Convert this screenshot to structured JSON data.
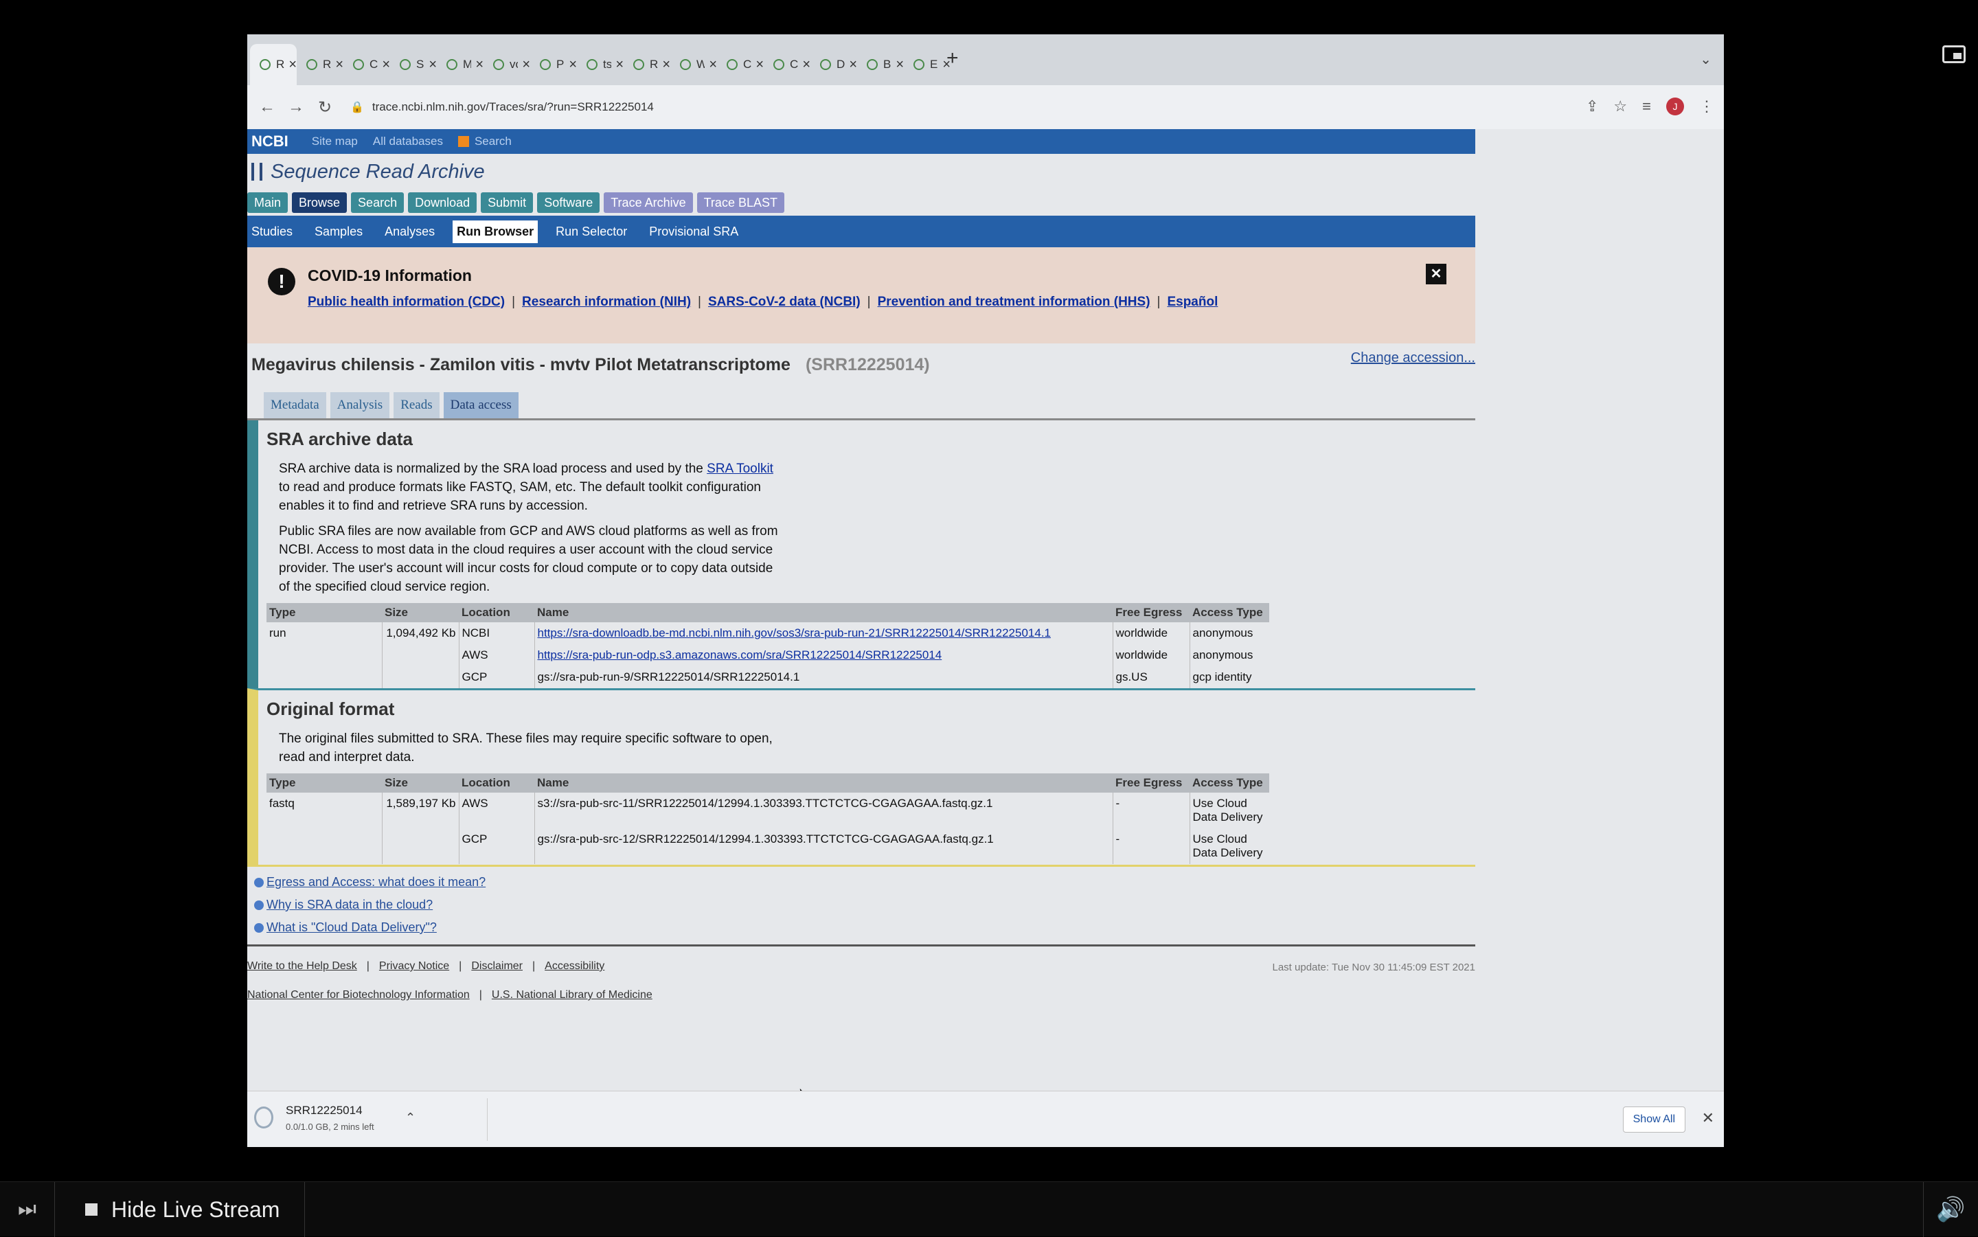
{
  "browser": {
    "tabs": [
      {
        "label": "Run Brow",
        "active": true
      },
      {
        "label": "Run Brow"
      },
      {
        "label": "Conda –"
      },
      {
        "label": "Sra Tools"
      },
      {
        "label": "MEGAHI"
      },
      {
        "label": "voutcn/m"
      },
      {
        "label": "Prokka:"
      },
      {
        "label": "tseeman"
      },
      {
        "label": "RStudio"
      },
      {
        "label": "Welcome"
      },
      {
        "label": "Conda +"
      },
      {
        "label": "Create E"
      },
      {
        "label": "Data visu"
      },
      {
        "label": "Basic his"
      },
      {
        "label": "Echo"
      }
    ],
    "url": "trace.ncbi.nlm.nih.gov/Traces/sra/?run=SRR12225014",
    "profile_initial": "J"
  },
  "ncbi": {
    "logo": "NCBI",
    "top_links": [
      "Site map",
      "All databases",
      "Search"
    ]
  },
  "sra": {
    "title": "Sequence Read Archive",
    "nav_main": [
      {
        "label": "Main"
      },
      {
        "label": "Browse",
        "active": true
      },
      {
        "label": "Search"
      },
      {
        "label": "Download"
      },
      {
        "label": "Submit"
      },
      {
        "label": "Software"
      },
      {
        "label": "Trace Archive",
        "trace": true
      },
      {
        "label": "Trace BLAST",
        "trace": true
      }
    ],
    "nav_sub": [
      {
        "label": "Studies"
      },
      {
        "label": "Samples"
      },
      {
        "label": "Analyses"
      },
      {
        "label": "Run Browser",
        "active": true
      },
      {
        "label": "Run Selector"
      },
      {
        "label": "Provisional SRA"
      }
    ]
  },
  "covid": {
    "title": "COVID-19 Information",
    "links": [
      "Public health information (CDC)",
      "Research information (NIH)",
      "SARS-CoV-2 data (NCBI)",
      "Prevention and treatment information (HHS)",
      "Español"
    ]
  },
  "run": {
    "title": "Megavirus chilensis - Zamilon vitis - mvtv Pilot Metatranscriptome",
    "accession": "(SRR12225014)",
    "change_accession": "Change accession...",
    "tabs": [
      "Metadata",
      "Analysis",
      "Reads",
      "Data access"
    ],
    "active_tab": "Data access"
  },
  "archive": {
    "title": "SRA archive data",
    "para1_pre": "SRA archive data is normalized by the SRA load process and used by the ",
    "para1_link": "SRA Toolkit",
    "para1_post": " to read and produce formats like FASTQ, SAM, etc. The default toolkit configuration enables it to find and retrieve SRA runs by accession.",
    "para2": "Public SRA files are now available from GCP and AWS cloud platforms as well as from NCBI. Access to most data in the cloud requires a user account with the cloud service provider. The user's account will incur costs for cloud compute or to copy data outside of the specified cloud service region.",
    "headers": [
      "Type",
      "Size",
      "Location",
      "Name",
      "Free Egress",
      "Access Type"
    ],
    "type": "run",
    "size": "1,094,492 Kb",
    "rows": [
      {
        "location": "NCBI",
        "name": "https://sra-downloadb.be-md.ncbi.nlm.nih.gov/sos3/sra-pub-run-21/SRR12225014/SRR12225014.1",
        "egress": "worldwide",
        "access": "anonymous",
        "link": true
      },
      {
        "location": "AWS",
        "name": "https://sra-pub-run-odp.s3.amazonaws.com/sra/SRR12225014/SRR12225014",
        "egress": "worldwide",
        "access": "anonymous",
        "link": true
      },
      {
        "location": "GCP",
        "name": "gs://sra-pub-run-9/SRR12225014/SRR12225014.1",
        "egress": "gs.US",
        "access": "gcp identity",
        "link": false
      }
    ]
  },
  "original": {
    "title": "Original format",
    "para": "The original files submitted to SRA. These files may require specific software to open, read and interpret data.",
    "headers": [
      "Type",
      "Size",
      "Location",
      "Name",
      "Free Egress",
      "Access Type"
    ],
    "type": "fastq",
    "size": "1,589,197 Kb",
    "rows": [
      {
        "location": "AWS",
        "name": "s3://sra-pub-src-11/SRR12225014/12994.1.303393.TTCTCTCG-CGAGAGAA.fastq.gz.1",
        "egress": "-",
        "access": "Use Cloud Data Delivery"
      },
      {
        "location": "GCP",
        "name": "gs://sra-pub-src-12/SRR12225014/12994.1.303393.TTCTCTCG-CGAGAGAA.fastq.gz.1",
        "egress": "-",
        "access": "Use Cloud Data Delivery"
      }
    ]
  },
  "faq": [
    "Egress and Access: what does it mean?",
    "Why is SRA data in the cloud?",
    "What is \"Cloud Data Delivery\"?"
  ],
  "footer": {
    "row1": [
      "Write to the Help Desk",
      "Privacy Notice",
      "Disclaimer",
      "Accessibility"
    ],
    "row2": [
      "National Center for Biotechnology Information",
      "U.S. National Library of Medicine"
    ],
    "last_update": "Last update: Tue Nov 30 11:45:09 EST 2021"
  },
  "download": {
    "name": "SRR12225014",
    "status": "0.0/1.0 GB, 2 mins left",
    "show_all": "Show All"
  },
  "stream": {
    "hide_label": "Hide Live Stream"
  }
}
